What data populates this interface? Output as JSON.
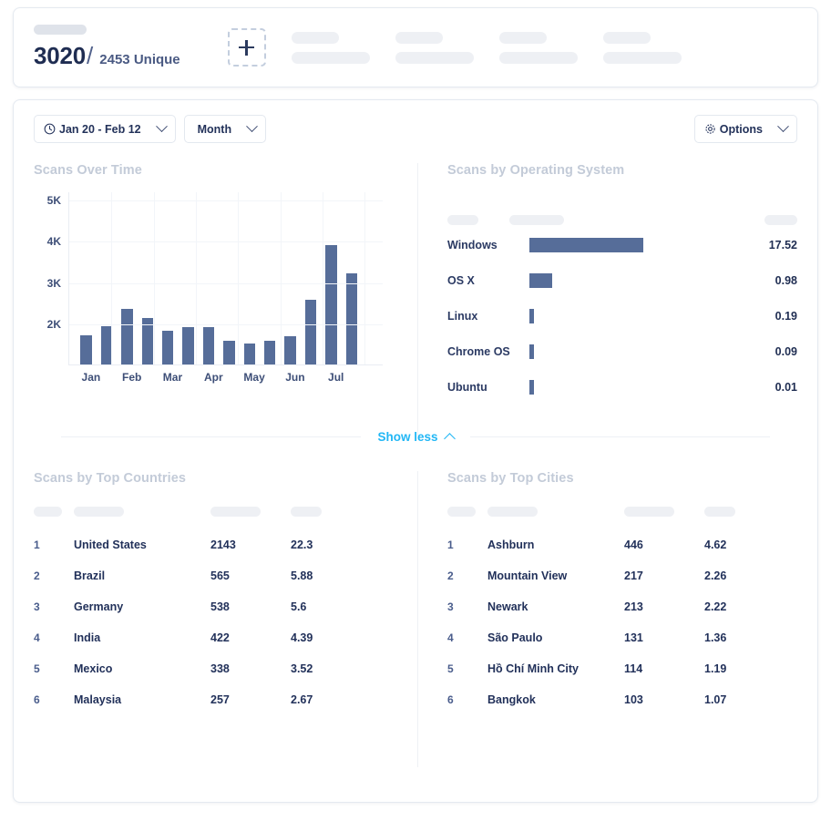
{
  "summary": {
    "total": "3020",
    "separator": "/",
    "unique": "2453 Unique",
    "add_icon": "plus-icon"
  },
  "filters": {
    "date_range": "Jan 20 - Feb 12",
    "date_icon": "clock-icon",
    "granularity": "Month",
    "options": "Options",
    "options_icon": "gear-icon",
    "chevron_icon": "chevron-down-icon"
  },
  "sections": {
    "scans_over_time": "Scans Over Time",
    "scans_by_os": "Scans by Operating System",
    "top_countries": "Scans by Top Countries",
    "top_cities": "Scans by Top Cities"
  },
  "show_less": {
    "label": "Show less",
    "icon": "chevron-up-icon"
  },
  "colors": {
    "bar": "#566d99",
    "link": "#22b7f5",
    "text_dark": "#22315a",
    "section_title": "#c3cbd8"
  },
  "chart_data": [
    {
      "type": "bar",
      "title": "Scans Over Time",
      "xlabel": "",
      "ylabel": "",
      "ylim": [
        1000,
        5200
      ],
      "yticks": [
        2000,
        3000,
        4000,
        5000
      ],
      "ytick_labels": [
        "2K",
        "3K",
        "4K",
        "5K"
      ],
      "grid": true,
      "categories": [
        "Jan",
        "Feb",
        "Mar",
        "Apr",
        "May",
        "Jun",
        "Jul"
      ],
      "x": [
        "Jan a",
        "Jan b",
        "Feb a",
        "Feb b",
        "Mar a",
        "Mar b",
        "Apr a",
        "Apr b",
        "May a",
        "May b",
        "Jun a",
        "Jun b",
        "Jul a",
        "Jul b"
      ],
      "values": [
        1700,
        1920,
        2350,
        2120,
        1810,
        1900,
        1900,
        1580,
        1500,
        1570,
        1680,
        2560,
        3900,
        3220
      ]
    },
    {
      "type": "bar",
      "orientation": "horizontal",
      "title": "Scans by Operating System",
      "categories": [
        "Windows",
        "OS X",
        "Linux",
        "Chrome OS",
        "Ubuntu"
      ],
      "values": [
        17.52,
        0.98,
        0.19,
        0.09,
        0.01
      ],
      "value_labels": [
        "17.52",
        "0.98",
        "0.19",
        "0.09",
        "0.01"
      ],
      "max": 17.52
    }
  ],
  "os_list": {
    "rows": [
      {
        "name": "Windows",
        "value": "17.52",
        "pct": 100.0
      },
      {
        "name": "OS X",
        "value": "0.98",
        "pct": 20.0
      },
      {
        "name": "Linux",
        "value": "0.19",
        "pct": 4.0
      },
      {
        "name": "Chrome OS",
        "value": "0.09",
        "pct": 4.0
      },
      {
        "name": "Ubuntu",
        "value": "0.01",
        "pct": 4.0
      }
    ]
  },
  "countries": {
    "rows": [
      {
        "rank": "1",
        "name": "United States",
        "scans": "2143",
        "pct": "22.3"
      },
      {
        "rank": "2",
        "name": "Brazil",
        "scans": "565",
        "pct": "5.88"
      },
      {
        "rank": "3",
        "name": "Germany",
        "scans": "538",
        "pct": "5.6"
      },
      {
        "rank": "4",
        "name": "India",
        "scans": "422",
        "pct": "4.39"
      },
      {
        "rank": "5",
        "name": "Mexico",
        "scans": "338",
        "pct": "3.52"
      },
      {
        "rank": "6",
        "name": "Malaysia",
        "scans": "257",
        "pct": "2.67"
      }
    ]
  },
  "cities": {
    "rows": [
      {
        "rank": "1",
        "name": "Ashburn",
        "scans": "446",
        "pct": "4.62"
      },
      {
        "rank": "2",
        "name": "Mountain View",
        "scans": "217",
        "pct": "2.26"
      },
      {
        "rank": "3",
        "name": "Newark",
        "scans": "213",
        "pct": "2.22"
      },
      {
        "rank": "4",
        "name": "São Paulo",
        "scans": "131",
        "pct": "1.36"
      },
      {
        "rank": "5",
        "name": "Hồ Chí Minh City",
        "scans": "114",
        "pct": "1.19"
      },
      {
        "rank": "6",
        "name": "Bangkok",
        "scans": "103",
        "pct": "1.07"
      }
    ]
  }
}
